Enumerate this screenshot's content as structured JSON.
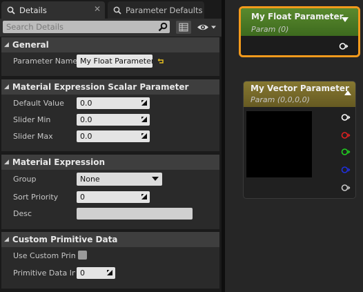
{
  "tabs": [
    {
      "label": "Details"
    },
    {
      "label": "Parameter Defaults"
    }
  ],
  "search": {
    "placeholder": "Search Details"
  },
  "colors": {
    "accent_orange": "#f39a1c",
    "float_header_green": "#4a7a24",
    "vector_header_olive": "#7b6e2d"
  },
  "categories": {
    "general": {
      "title": "General",
      "param_name_label": "Parameter Name",
      "param_name_value": "My Float Parameter"
    },
    "scalar": {
      "title": "Material Expression Scalar Parameter",
      "default_label": "Default Value",
      "default_value": "0.0",
      "min_label": "Slider Min",
      "min_value": "0.0",
      "max_label": "Slider Max",
      "max_value": "0.0"
    },
    "expression": {
      "title": "Material Expression",
      "group_label": "Group",
      "group_value": "None",
      "priority_label": "Sort Priority",
      "priority_value": "0",
      "desc_label": "Desc",
      "desc_value": ""
    },
    "custom": {
      "title": "Custom Primitive Data",
      "use_label": "Use Custom Prim",
      "use_checked": false,
      "index_label": "Primitive Data Inc",
      "index_value": "0"
    }
  },
  "graph": {
    "float_node": {
      "title": "My Float Parameter",
      "subtitle": "Param (0)"
    },
    "vector_node": {
      "title": "My Vector Parameter",
      "subtitle": "Param (0,0,0,0)"
    }
  }
}
